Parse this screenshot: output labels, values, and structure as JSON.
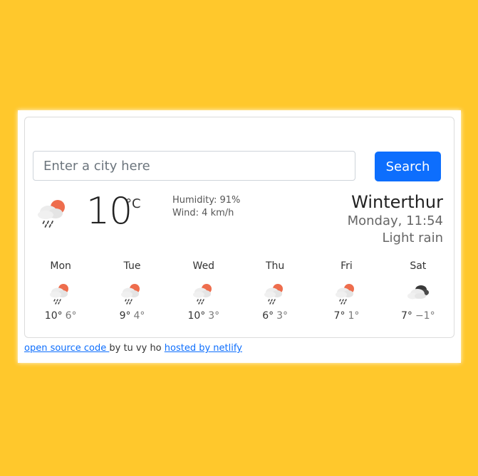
{
  "search": {
    "placeholder": "Enter a city here",
    "button_label": "Search"
  },
  "current": {
    "icon": "rain-sun-icon",
    "temperature": "10",
    "unit": "°C",
    "humidity": "Humidity: 91%",
    "wind": "Wind: 4 km/h",
    "city": "Winterthur",
    "datetime": "Monday, 11:54",
    "condition": "Light rain"
  },
  "forecast": [
    {
      "day": "Mon",
      "icon": "rain-sun-icon",
      "max": "10°",
      "min": "6°"
    },
    {
      "day": "Tue",
      "icon": "rain-sun-icon",
      "max": "9°",
      "min": "4°"
    },
    {
      "day": "Wed",
      "icon": "rain-sun-icon",
      "max": "10°",
      "min": "3°"
    },
    {
      "day": "Thu",
      "icon": "rain-sun-icon",
      "max": "6°",
      "min": "3°"
    },
    {
      "day": "Fri",
      "icon": "rain-sun-icon",
      "max": "7°",
      "min": "1°"
    },
    {
      "day": "Sat",
      "icon": "broken-clouds-icon",
      "max": "7°",
      "min": "−1°"
    }
  ],
  "footer": {
    "source_link": "open source code ",
    "by_text": " by tu vy ho ",
    "host_link": "hosted by netlify"
  },
  "colors": {
    "background": "#ffc82c",
    "accent": "#0d6efd",
    "sun": "#ee6d4d",
    "cloud": "#eeeeee"
  }
}
